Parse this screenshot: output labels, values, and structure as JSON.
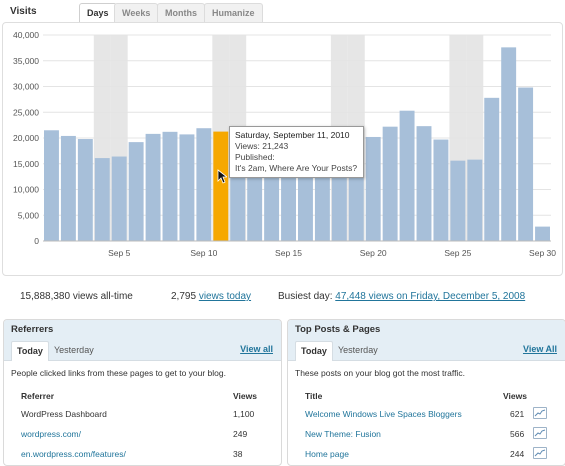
{
  "header": {
    "title": "Visits",
    "tabs": [
      {
        "label": "Days",
        "active": true
      },
      {
        "label": "Weeks",
        "active": false
      },
      {
        "label": "Months",
        "active": false
      },
      {
        "label": "Humanize",
        "active": false
      }
    ]
  },
  "chart_data": {
    "type": "bar",
    "ylim": [
      0,
      40000
    ],
    "yticks": [
      "0",
      "5,000",
      "10,000",
      "15,000",
      "20,000",
      "25,000",
      "30,000",
      "35,000",
      "40,000"
    ],
    "ytick_values": [
      0,
      5000,
      10000,
      15000,
      20000,
      25000,
      30000,
      35000,
      40000
    ],
    "xtick_labels": [
      {
        "label": "Sep 5",
        "day": 5
      },
      {
        "label": "Sep 10",
        "day": 10
      },
      {
        "label": "Sep 15",
        "day": 15
      },
      {
        "label": "Sep 20",
        "day": 20
      },
      {
        "label": "Sep 25",
        "day": 25
      },
      {
        "label": "Sep 30",
        "day": 30
      }
    ],
    "days": [
      1,
      2,
      3,
      4,
      5,
      6,
      7,
      8,
      9,
      10,
      11,
      12,
      13,
      14,
      15,
      16,
      17,
      18,
      19,
      20,
      21,
      22,
      23,
      24,
      25,
      26,
      27,
      28,
      29,
      30
    ],
    "values": [
      21500,
      20400,
      19800,
      16100,
      16400,
      19200,
      20800,
      21200,
      20700,
      21900,
      21243,
      21000,
      20500,
      19700,
      20300,
      20800,
      21500,
      20600,
      19900,
      20200,
      22200,
      25300,
      22300,
      19700,
      15600,
      15800,
      27800,
      37600,
      29800,
      2795
    ],
    "highlight_day": 11,
    "weekend_days": [
      4,
      5,
      11,
      12,
      18,
      19,
      25,
      26
    ],
    "colors": {
      "bar": "#a7bfd9",
      "highlight": "#f6a800",
      "weekend_band": "#e6e6e6",
      "grid": "#e4e4e4"
    }
  },
  "tooltip": {
    "date": "Saturday, September 11, 2010",
    "views": "Views: 21,243",
    "published": "Published:",
    "post": "It's 2am, Where Are Your Posts?"
  },
  "stats": {
    "all_time": "15,888,380 views all-time",
    "today_count": "2,795",
    "today_link": "views today",
    "busiest_label": "Busiest day:",
    "busiest_link": "47,448 views on Friday, December 5, 2008"
  },
  "referrers": {
    "title": "Referrers",
    "tabs": [
      "Today",
      "Yesterday"
    ],
    "view_all": "View all",
    "description": "People clicked links from these pages to get to your blog.",
    "col_name": "Referrer",
    "col_views": "Views",
    "rows": [
      {
        "name": "WordPress Dashboard",
        "views": "1,100",
        "link": false
      },
      {
        "name": "wordpress.com/",
        "views": "249",
        "link": true
      },
      {
        "name": "en.wordpress.com/features/",
        "views": "38",
        "link": true
      }
    ]
  },
  "top_posts": {
    "title": "Top Posts & Pages",
    "tabs": [
      "Today",
      "Yesterday"
    ],
    "view_all": "View All",
    "description": "These posts on your blog got the most traffic.",
    "col_name": "Title",
    "col_views": "Views",
    "rows": [
      {
        "name": "Welcome Windows Live Spaces Bloggers",
        "views": "621"
      },
      {
        "name": "New Theme: Fusion",
        "views": "566"
      },
      {
        "name": "Home page",
        "views": "244"
      }
    ]
  }
}
